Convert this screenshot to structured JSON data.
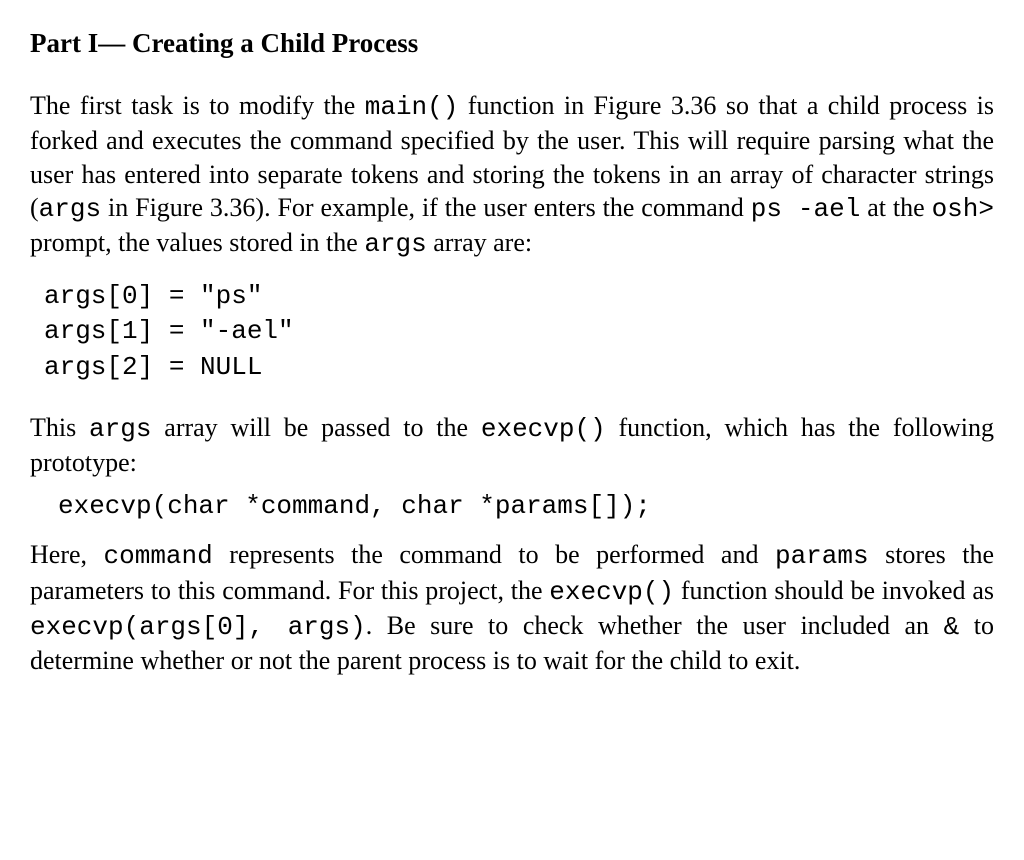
{
  "heading": {
    "part": "Part I",
    "dash": "—",
    "title": " Creating a Child Process"
  },
  "para1": {
    "t1": "The first task is to modify the ",
    "c1": "main()",
    "t2": " function in Figure 3.36 so that a child process is forked and executes the command specified by the user. This will require parsing what the user has entered into separate tokens and storing the tokens in an array of character strings (",
    "c2": "args",
    "t3": " in Figure 3.36). For example, if the user enters the command ",
    "c3": "ps  -ael",
    "t4": " at the ",
    "c4": "osh>",
    "t5": " prompt, the values stored in the ",
    "c5": "args",
    "t6": " array are:"
  },
  "codeblock1": "args[0] = \"ps\"\nargs[1] = \"-ael\"\nargs[2] = NULL",
  "para2": {
    "t1": "This ",
    "c1": "args",
    "t2": " array will be passed to the ",
    "c2": "execvp()",
    "t3": " function, which has the following prototype:"
  },
  "codeblock2": "execvp(char *command, char *params[]);",
  "para3": {
    "t1": "Here, ",
    "c1": "command",
    "t2": " represents the command to be performed and ",
    "c2": "params",
    "t3": " stores the parameters to this command. For this project, the ",
    "c3": "execvp()",
    "t4": " function should be invoked as ",
    "c4": "execvp(args[0], args)",
    "t5": ". Be sure to check whether the user included an ",
    "c5": "&",
    "t6": " to determine whether or not the parent process is to wait for the child to exit."
  }
}
